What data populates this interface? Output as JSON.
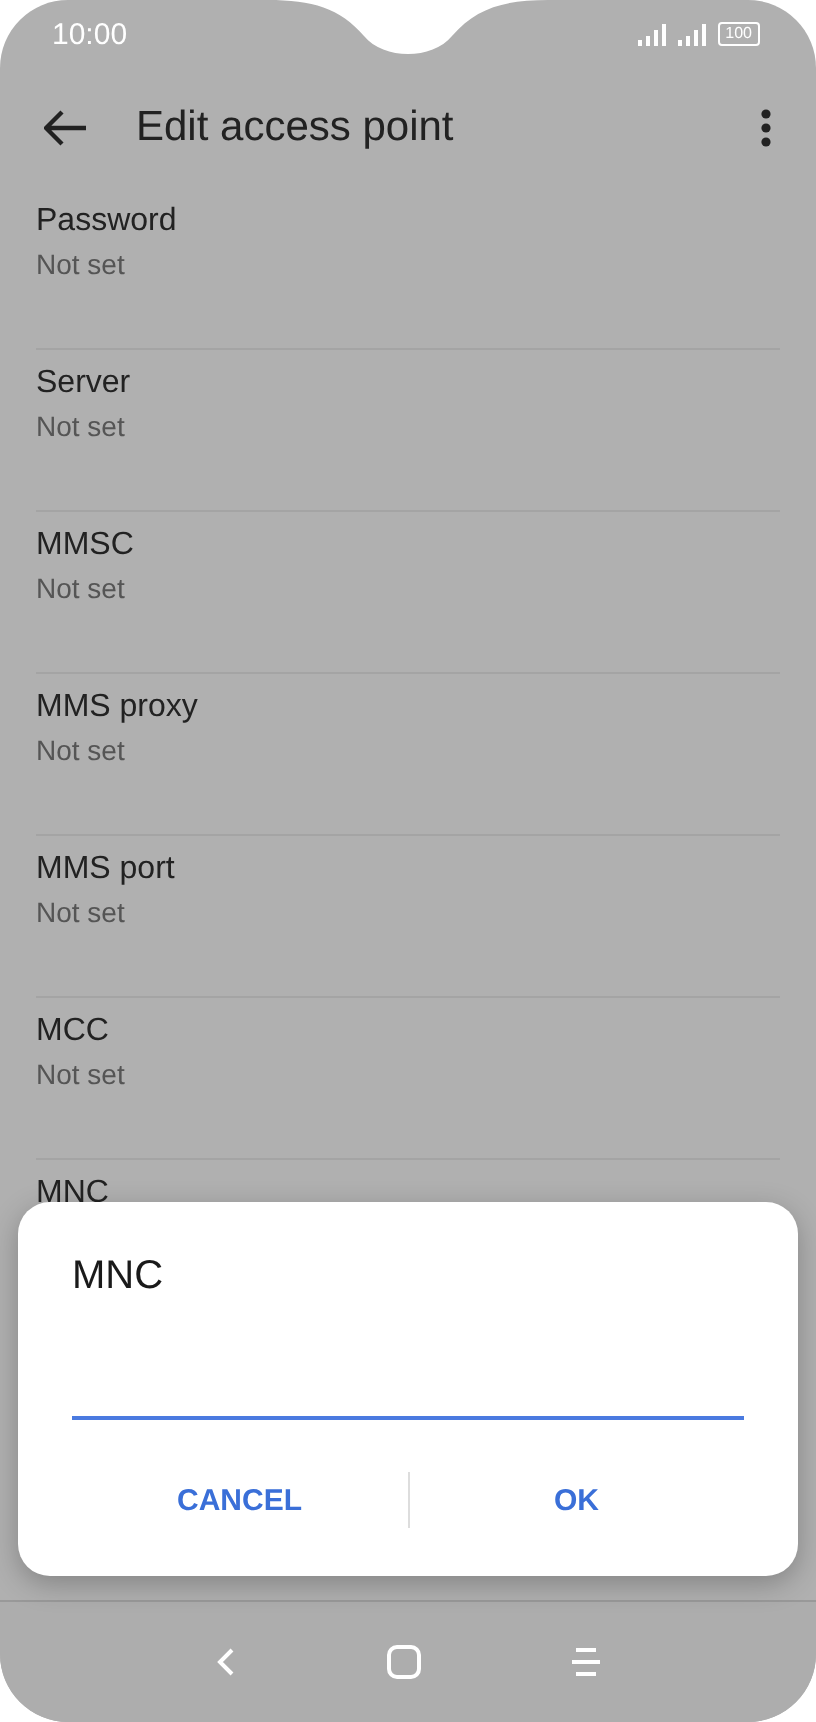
{
  "status_bar": {
    "time": "10:00",
    "battery": "100"
  },
  "app_bar": {
    "title": "Edit access point"
  },
  "settings": [
    {
      "title": "Password",
      "summary": "Not set"
    },
    {
      "title": "Server",
      "summary": "Not set"
    },
    {
      "title": "MMSC",
      "summary": "Not set"
    },
    {
      "title": "MMS proxy",
      "summary": "Not set"
    },
    {
      "title": "MMS port",
      "summary": "Not set"
    },
    {
      "title": "MCC",
      "summary": "Not set"
    },
    {
      "title": "MNC"
    }
  ],
  "dialog": {
    "title": "MNC",
    "buttons": [
      "CANCEL",
      "OK"
    ]
  }
}
